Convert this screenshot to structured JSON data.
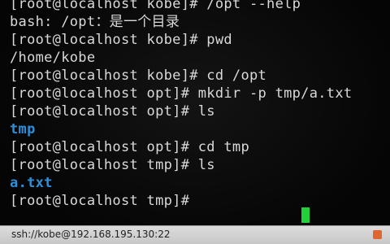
{
  "terminal": {
    "lines": [
      "bash: /opt：是一个目录",
      "[root@localhost kobe]# pwd",
      "/home/kobe",
      "[root@localhost kobe]# cd /opt",
      "[root@localhost opt]# mkdir -p tmp/a.txt",
      "[root@localhost opt]# ls",
      "tmp",
      "[root@localhost opt]# cd tmp",
      "[root@localhost tmp]# ls",
      "a.txt",
      "[root@localhost tmp]# "
    ],
    "partial_top_line": "[root@localhost kobe]# /opt --help",
    "cursor_color": "#22d13a",
    "directory_color": "#2e8fd8"
  },
  "status_bar": {
    "connection": "ssh://kobe@192.168.195.130:22"
  }
}
